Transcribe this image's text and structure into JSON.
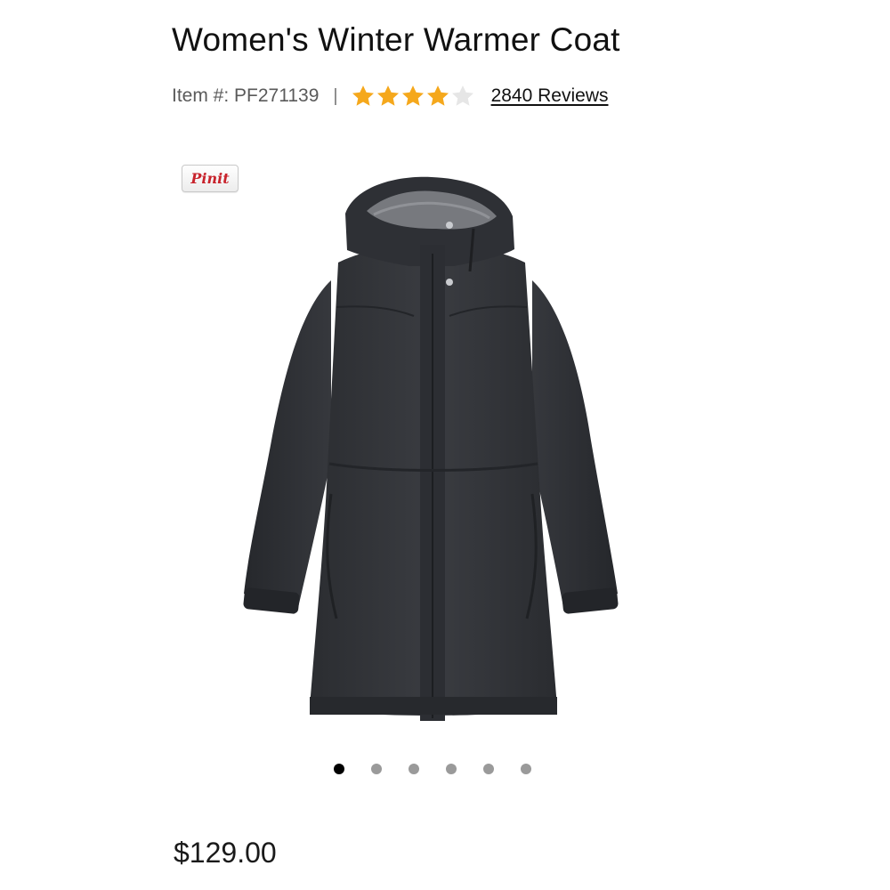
{
  "product": {
    "title": "Women's Winter Warmer Coat",
    "item_number": "Item #: PF271139",
    "separator": "|",
    "rating": {
      "value": 4,
      "max": 5
    },
    "reviews_label": "2840 Reviews",
    "price": "$129.00"
  },
  "pin_button": {
    "label": "Pinit"
  },
  "image_pager": {
    "count": 6,
    "active_index": 0
  },
  "colors": {
    "star_filled": "#f5a81c",
    "star_empty": "#e6e6e6",
    "pin_red": "#c8232c",
    "dot_active": "#000000",
    "dot_inactive": "#9a9a9a"
  },
  "icons": {
    "star": "star-icon",
    "pin": "pin-it-icon",
    "product_photo": "winter-coat-image"
  }
}
